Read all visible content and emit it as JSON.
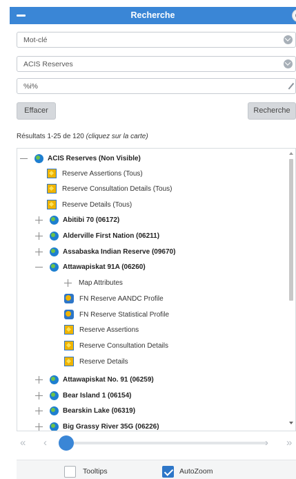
{
  "header": {
    "title": "Recherche"
  },
  "fields": {
    "type_value": "Mot-clé",
    "layer_value": "ACIS Reserves",
    "query_value": "%i%"
  },
  "buttons": {
    "clear": "Effacer",
    "search": "Recherche"
  },
  "results": {
    "count_text": "Résultats 1-25 de 120 ",
    "hint": "(cliquez sur la carte)"
  },
  "tree": {
    "root": {
      "label": "ACIS Reserves (Non Visible)"
    },
    "root_children": [
      {
        "label": "Reserve Assertions (Tous)",
        "icon": "layer-icon"
      },
      {
        "label": "Reserve Consultation Details (Tous)",
        "icon": "layer-icon"
      },
      {
        "label": "Reserve Details (Tous)",
        "icon": "layer-icon"
      }
    ],
    "reserves": [
      {
        "label": "Abitibi 70 (06172)",
        "expanded": false
      },
      {
        "label": "Alderville First Nation (06211)",
        "expanded": false
      },
      {
        "label": "Assabaska Indian Reserve (09670)",
        "expanded": false
      },
      {
        "label": "Attawapiskat 91A (06260)",
        "expanded": true
      },
      {
        "label": "Attawapiskat No. 91 (06259)",
        "expanded": false
      },
      {
        "label": "Bear Island 1 (06154)",
        "expanded": false
      },
      {
        "label": "Bearskin Lake (06319)",
        "expanded": false
      },
      {
        "label": "Big Grassy River 35G (06226)",
        "expanded": false
      }
    ],
    "expanded_children": [
      {
        "label": "Map Attributes",
        "icon": "plus-toggle"
      },
      {
        "label": "FN Reserve AANDC Profile",
        "icon": "fn-profile-icon"
      },
      {
        "label": "FN Reserve Statistical Profile",
        "icon": "fn-profile-icon"
      },
      {
        "label": "Reserve Assertions",
        "icon": "layer-icon"
      },
      {
        "label": "Reserve Consultation Details",
        "icon": "layer-icon"
      },
      {
        "label": "Reserve Details",
        "icon": "layer-icon"
      }
    ]
  },
  "pager": {
    "first": "«",
    "prev": "‹",
    "next": "›",
    "last": "»",
    "position": 0.0
  },
  "footer": {
    "tooltips": {
      "label": "Tooltips",
      "checked": false
    },
    "autozoom": {
      "label": "AutoZoom",
      "checked": true
    }
  }
}
